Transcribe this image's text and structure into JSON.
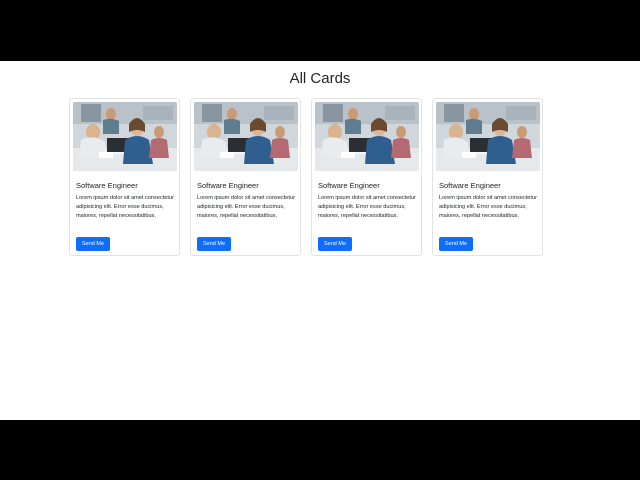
{
  "page": {
    "title": "All Cards"
  },
  "cards": [
    {
      "title": "Software Engineer",
      "text": "Lorem ipsum dolor sit amet consectetur adipisicing elit. Error esse ducimus, maiores, repellat necessitatibus,",
      "button_label": "Send Me",
      "image_icon": "office-photo-icon"
    },
    {
      "title": "Software Engineer",
      "text": "Lorem ipsum dolor sit amet consectetur adipisicing elit. Error esse ducimus, maiores, repellat necessitatibus,",
      "button_label": "Send Me",
      "image_icon": "office-photo-icon"
    },
    {
      "title": "Software Engineer",
      "text": "Lorem ipsum dolor sit amet consectetur adipisicing elit. Error esse ducimus, maiores, repellat necessitatibus,",
      "button_label": "Send Me",
      "image_icon": "office-photo-icon"
    },
    {
      "title": "Software Engineer",
      "text": "Lorem ipsum dolor sit amet consectetur adipisicing elit. Error esse ducimus, maiores, repellat necessitatibus,",
      "button_label": "Send Me",
      "image_icon": "office-photo-icon"
    }
  ],
  "colors": {
    "accent": "#0d6efd",
    "letterbox": "#000000",
    "background": "#ffffff"
  }
}
